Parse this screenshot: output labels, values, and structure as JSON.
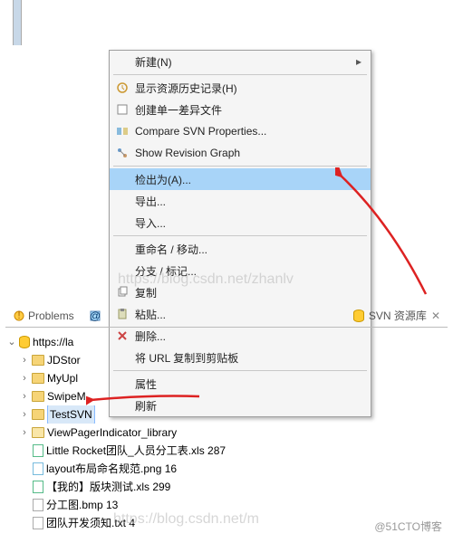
{
  "menu": {
    "new": "新建(N)",
    "history": "显示资源历史记录(H)",
    "diff": "创建单一差异文件",
    "compare": "Compare SVN Properties...",
    "graph": "Show Revision Graph",
    "checkout": "检出为(A)...",
    "export": "导出...",
    "import": "导入...",
    "rename": "重命名 / 移动...",
    "branch": "分支 / 标记...",
    "copy": "复制",
    "paste": "粘贴...",
    "delete": "删除...",
    "copyurl": "将 URL 复制到剪贴板",
    "props": "属性",
    "refresh": "刷新"
  },
  "tabs": {
    "problems": "Problems",
    "svn": "SVN 资源库"
  },
  "tree": {
    "root": "https://la",
    "items": [
      {
        "name": "JDStor",
        "type": "folder"
      },
      {
        "name": "MyUpl",
        "type": "folder"
      },
      {
        "name": "SwipeM",
        "type": "folder"
      },
      {
        "name": "TestSVN",
        "type": "folder",
        "selected": true
      },
      {
        "name": "ViewPagerIndicator_library",
        "type": "folder-open"
      }
    ],
    "files": [
      {
        "name": "Little Rocket团队_人员分工表.xls 287",
        "type": "xls"
      },
      {
        "name": "layout布局命名规范.png 16",
        "type": "png"
      },
      {
        "name": "【我的】版块测试.xls 299",
        "type": "xls"
      },
      {
        "name": "分工图.bmp 13",
        "type": "bmp"
      },
      {
        "name": "团队开发须知.txt 4",
        "type": "txt"
      }
    ]
  },
  "wm1": "https://blog.csdn.net/zhanlv",
  "wm2": "https://blog.csdn.net/m",
  "credit": "@51CTO博客"
}
